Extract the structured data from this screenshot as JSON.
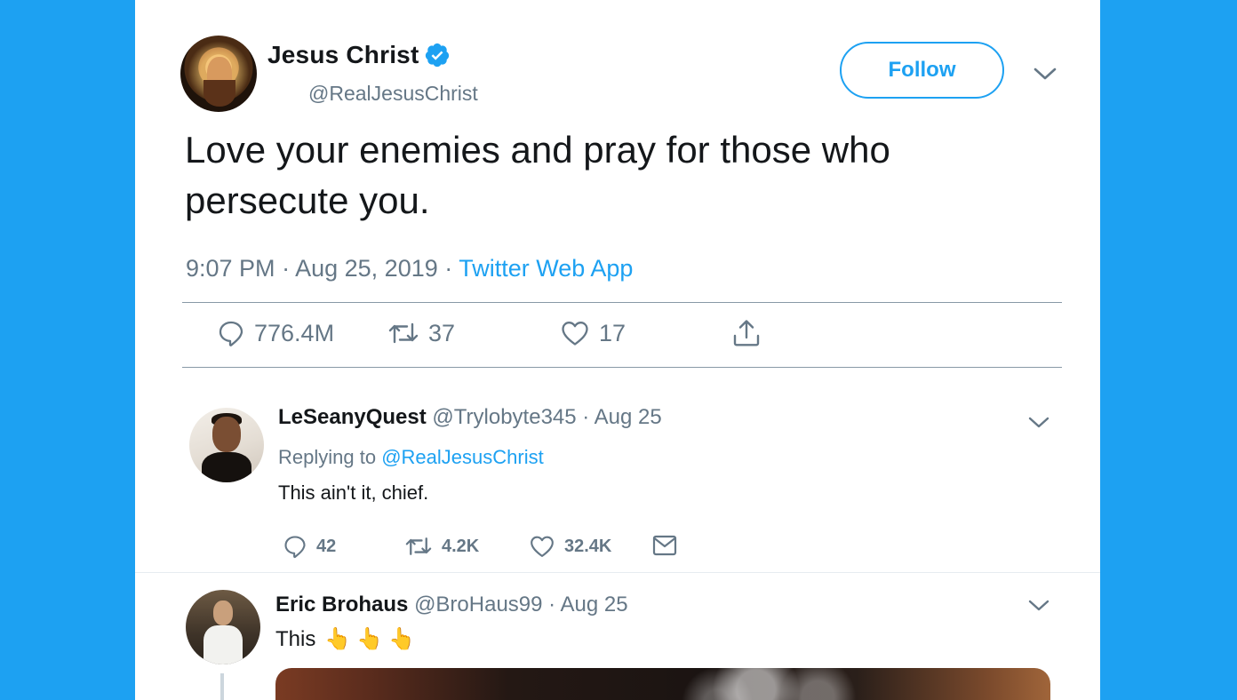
{
  "colors": {
    "background": "#1da1f2",
    "accent": "#1da1f2",
    "secondary_text": "#657786",
    "primary_text": "#14171a"
  },
  "main_tweet": {
    "name": "Jesus Christ",
    "verified_icon": "verified-badge-icon",
    "handle": "@RealJesusChrist",
    "follow_label": "Follow",
    "text": "Love your enemies and pray for those who persecute you.",
    "time": "9:07 PM",
    "separator": "·",
    "date": "Aug 25, 2019",
    "source": "Twitter Web App",
    "stats": {
      "replies": "776.4M",
      "retweets": "37",
      "likes": "17"
    },
    "icons": {
      "reply": "reply-bubble-icon",
      "retweet": "retweet-icon",
      "like": "heart-icon",
      "share": "share-upload-icon",
      "menu": "chevron-down-icon"
    }
  },
  "replies": [
    {
      "name": "LeSeanyQuest",
      "handle": "@Trylobyte345",
      "date": "· Aug 25",
      "replying_prefix": "Replying to",
      "replying_handle": "@RealJesusChrist",
      "text": "This ain't it, chief.",
      "stats": {
        "replies": "42",
        "retweets": "4.2K",
        "likes": "32.4K"
      },
      "icons": {
        "reply": "reply-bubble-icon",
        "retweet": "retweet-icon",
        "like": "heart-icon",
        "message": "envelope-icon",
        "menu": "chevron-down-icon"
      }
    },
    {
      "name": "Eric Brohaus",
      "handle": "@BroHaus99",
      "date": "· Aug 25",
      "text": "This",
      "emoji": "👆👆👆",
      "icons": {
        "menu": "chevron-down-icon"
      }
    }
  ]
}
